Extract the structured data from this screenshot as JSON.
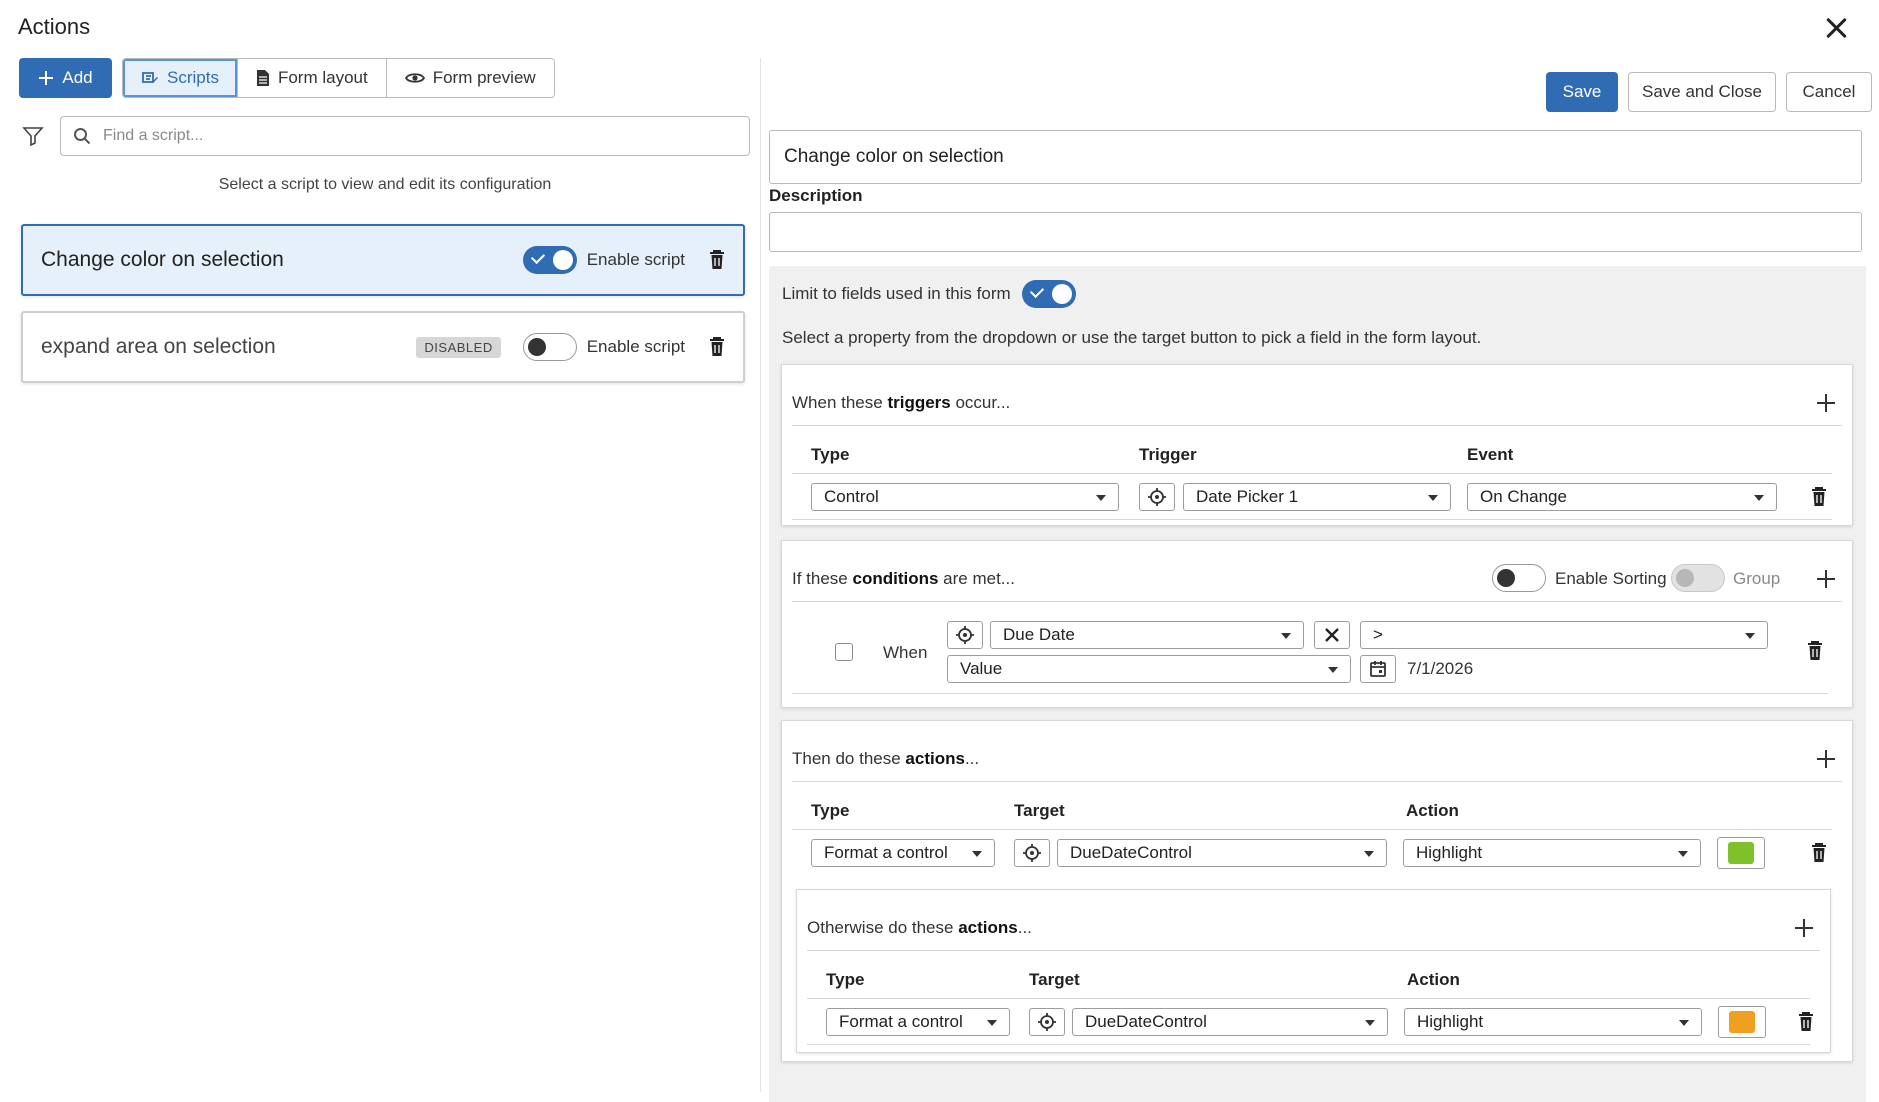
{
  "window": {
    "title": "Actions"
  },
  "toolbar": {
    "add_label": "Add",
    "tabs": [
      {
        "label": "Scripts",
        "icon": "script-icon",
        "active": true
      },
      {
        "label": "Form layout",
        "icon": "document-icon",
        "active": false
      },
      {
        "label": "Form preview",
        "icon": "eye-icon",
        "active": false
      }
    ]
  },
  "search": {
    "placeholder": "Find a script...",
    "value": ""
  },
  "hint": "Select a script to view and edit its configuration",
  "scripts": [
    {
      "name": "Change color on selection",
      "enabled": true,
      "disabled_badge": "",
      "enable_label": "Enable script"
    },
    {
      "name": "expand area on selection",
      "enabled": false,
      "disabled_badge": "DISABLED",
      "enable_label": "Enable script"
    }
  ],
  "actions": {
    "save": "Save",
    "save_close": "Save and Close",
    "cancel": "Cancel"
  },
  "editor": {
    "script_name": "Change color on selection",
    "description_label": "Description",
    "description_value": "",
    "limit_label": "Limit to fields used in this form",
    "limit_enabled": true,
    "select_hint": "Select a property from the dropdown or use the target button to pick a field in the form layout."
  },
  "triggers": {
    "title_pre": "When these ",
    "title_bold": "triggers",
    "title_post": " occur...",
    "headers": {
      "type": "Type",
      "trigger": "Trigger",
      "event": "Event"
    },
    "row": {
      "type": "Control",
      "trigger": "Date Picker 1",
      "event": "On Change"
    }
  },
  "conditions": {
    "title_pre": "If these ",
    "title_bold": "conditions",
    "title_post": " are met...",
    "enable_sorting_label": "Enable Sorting",
    "group_label": "Group",
    "when_label": "When",
    "field": "Due Date",
    "operator": ">",
    "value_type": "Value",
    "value": "7/1/2026"
  },
  "then_actions": {
    "title_pre": "Then do these ",
    "title_bold": "actions",
    "title_post": "...",
    "headers": {
      "type": "Type",
      "target": "Target",
      "action": "Action"
    },
    "row": {
      "type": "Format a control",
      "target": "DueDateControl",
      "action": "Highlight",
      "color": "#7fc12a"
    }
  },
  "otherwise_actions": {
    "title_pre": "Otherwise do these ",
    "title_bold": "actions",
    "title_post": "...",
    "headers": {
      "type": "Type",
      "target": "Target",
      "action": "Action"
    },
    "row": {
      "type": "Format a control",
      "target": "DueDateControl",
      "action": "Highlight",
      "color": "#f0a020"
    }
  },
  "colors": {
    "accent": "#2f6cb3",
    "selected_bg": "#e6f0fb",
    "config_bg": "#f0f0f0"
  }
}
